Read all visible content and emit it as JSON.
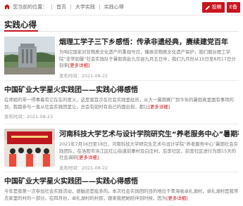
{
  "breadcrumb": {
    "label": "您当前的位置：",
    "items": [
      "首页",
      "大学实践",
      "实践心得"
    ]
  },
  "actions": {
    "submit_label": "投稿",
    "backup_label": "E备"
  },
  "section": {
    "title": "实践心得"
  },
  "articles": [
    {
      "title": "烟理工学子三下乡感悟：传承非遗经典，赓续建党百年",
      "summary": "为响应国家对非物质文化遗产的重视号召，播扬非物质文化遗产保护，我们烟台理工学院“非常如馨”社会实践队于暑假奔赴九华县九月五日中，我们九月份从15日至8月17日分别来",
      "more": "[更多详细]",
      "date": "发布时间：2021-08-22"
    },
    {
      "title": "中国矿业大学星火实践团——实践心得感悟",
      "summary": "在师姐的带一得事着有它在在的度义，这是我首次在社会实践里经历，从大一暑期赛厂到今年的暑假真里面有事项的到，我都参与一直从社会实践团里让，总会有如时有自己的面出现，都让",
      "more": "[更多详细]",
      "date": "发布时间：2021-08-23"
    },
    {
      "title": "河南科技大学艺术与设计学院研究生“养老服务中心”暑期社会实践",
      "summary": "2021年7月16日至18日，河南科技大学研究生艺术与设计学院“养老服务中心”暑期社会实践团队，在洛阳市洛江区红山街道前寨村及白庄村，后李社区，前营社区进行为期15天的社会调研",
      "more": "[更多详细]",
      "date": "发布时间：2021-08-22"
    },
    {
      "title": "中国矿业大学星火实践团——实践心得感悟",
      "summary": "今年是我第一次参加社会实践活动，感触还是挺多的。本次社会实践团的目的地位于青海省卓扎湖村，卓扎湖村是我常去家里的村的一部分。在四月份，卓扎湖村的村民，跟来我把她陪伴到时候，因为",
      "more": "[更多详细]",
      "date": ""
    }
  ]
}
